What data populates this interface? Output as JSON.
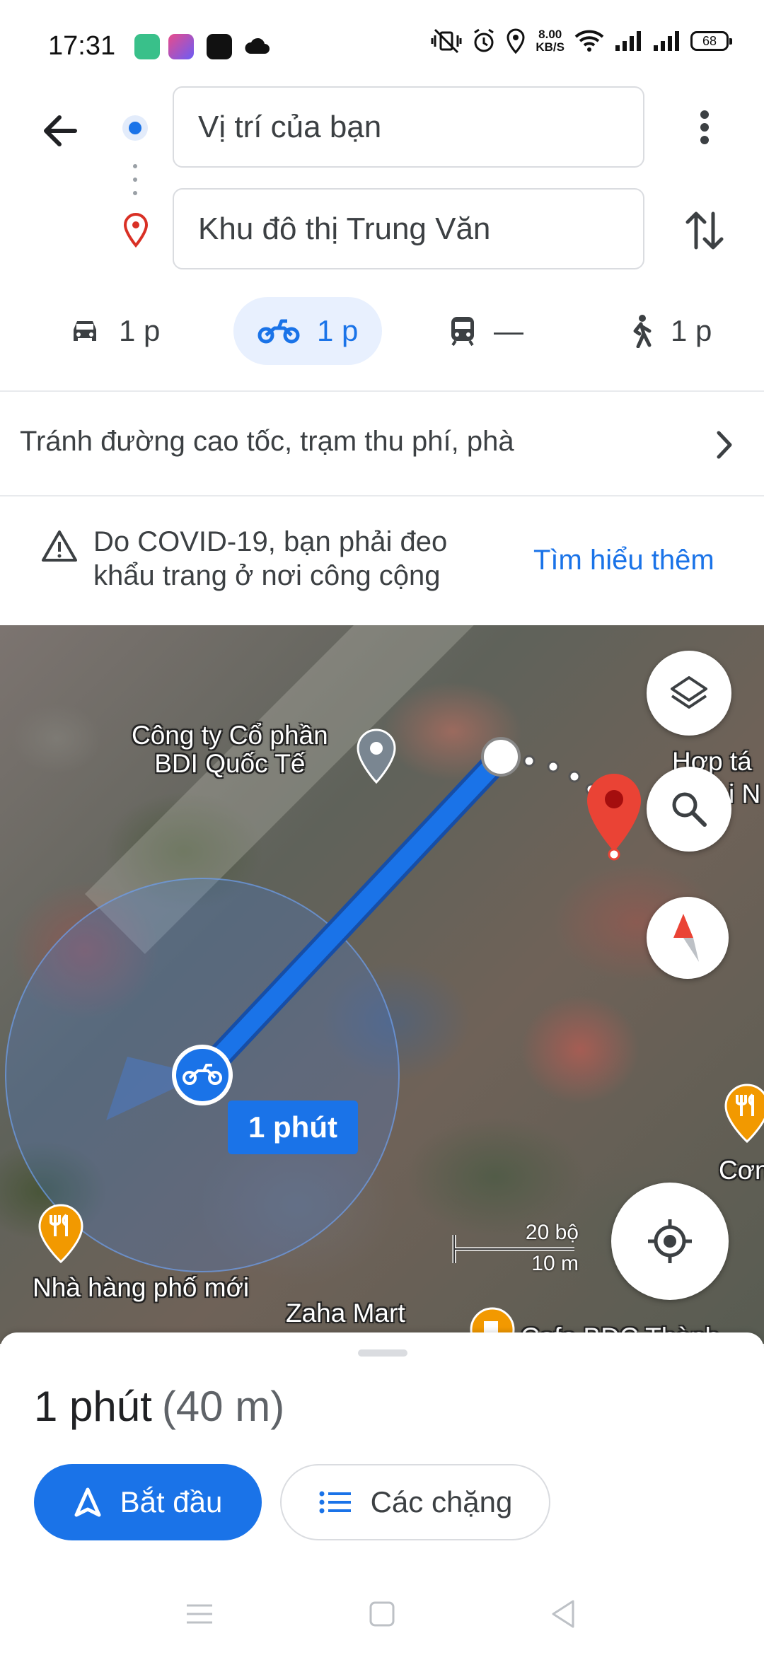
{
  "status_bar": {
    "time": "17:31",
    "net_speed_value": "8.00",
    "net_speed_unit": "KB/S",
    "battery": "68",
    "icons": [
      "vibrate-off-icon",
      "alarm-icon",
      "location-icon",
      "wifi-icon",
      "signal-icon",
      "signal-icon",
      "battery-icon"
    ],
    "app_icons": [
      "app-icon",
      "app-icon",
      "app-icon",
      "cloud-icon"
    ]
  },
  "search": {
    "origin": "Vị trí của bạn",
    "destination": "Khu đô thị Trung Văn"
  },
  "modes": [
    {
      "icon": "car-icon",
      "label": "1 p"
    },
    {
      "icon": "motorbike-icon",
      "label": "1 p",
      "active": true
    },
    {
      "icon": "transit-icon",
      "label": "—"
    },
    {
      "icon": "walk-icon",
      "label": "1 p"
    }
  ],
  "options": {
    "label": "Tránh đường cao tốc, trạm thu phí, phà"
  },
  "notice": {
    "text": "Do COVID-19, bạn phải đeo khẩu trang ở nơi công cộng",
    "link": "Tìm hiểu thêm"
  },
  "map": {
    "places": {
      "company": "Công ty Cổ phần BDI Quốc Tế",
      "company_line1": "Công ty Cổ phần",
      "company_line2": "BDI Quốc Tế",
      "hop_tac": "Hợp tá",
      "hop_tac_2": "i N",
      "restaurant": "Nhà hàng phố mới",
      "mart": "Zaha Mart",
      "com": "Cơn",
      "cafe": "Cafe BDC Thành"
    },
    "route_duration": "1 phút",
    "scale": {
      "top": "20 bộ",
      "bottom": "10 m"
    },
    "colors": {
      "route": "#1a73e8",
      "pin": "#ea4335",
      "restaurant": "#f29900"
    }
  },
  "summary": {
    "duration": "1 phút",
    "distance": "(40 m)"
  },
  "actions": {
    "start": "Bắt đầu",
    "steps": "Các chặng"
  }
}
